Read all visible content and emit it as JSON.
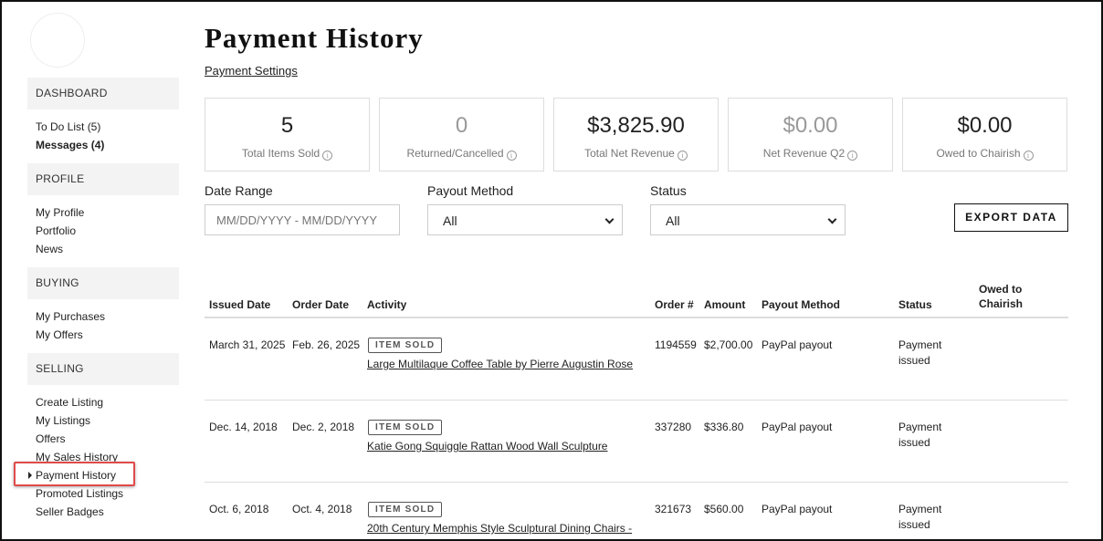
{
  "sidebar": {
    "sections": [
      {
        "title": "DASHBOARD",
        "items": [
          {
            "label": "To Do List (5)",
            "bold": false
          },
          {
            "label": "Messages (4)",
            "bold": true
          }
        ]
      },
      {
        "title": "PROFILE",
        "items": [
          {
            "label": "My Profile"
          },
          {
            "label": "Portfolio"
          },
          {
            "label": "News"
          }
        ]
      },
      {
        "title": "BUYING",
        "items": [
          {
            "label": "My Purchases"
          },
          {
            "label": "My Offers"
          }
        ]
      },
      {
        "title": "SELLING",
        "items": [
          {
            "label": "Create Listing"
          },
          {
            "label": "My Listings"
          },
          {
            "label": "Offers"
          },
          {
            "label": "My Sales History"
          },
          {
            "label": "Payment History",
            "active": true
          },
          {
            "label": "Promoted Listings"
          },
          {
            "label": "Seller Badges"
          }
        ]
      }
    ]
  },
  "page": {
    "title": "Payment History",
    "settings_link": "Payment Settings"
  },
  "stats": [
    {
      "value": "5",
      "label": "Total Items Sold",
      "muted": false
    },
    {
      "value": "0",
      "label": "Returned/Cancelled",
      "muted": true
    },
    {
      "value": "$3,825.90",
      "label": "Total Net Revenue",
      "muted": false
    },
    {
      "value": "$0.00",
      "label": "Net Revenue Q2",
      "muted": true
    },
    {
      "value": "$0.00",
      "label": "Owed to Chairish",
      "muted": false
    }
  ],
  "filters": {
    "date_range_label": "Date Range",
    "date_range_placeholder": "MM/DD/YYYY - MM/DD/YYYY",
    "payout_label": "Payout Method",
    "payout_value": "All",
    "status_label": "Status",
    "status_value": "All",
    "export_label": "EXPORT DATA"
  },
  "table": {
    "headers": {
      "issued_date": "Issued Date",
      "order_date": "Order Date",
      "activity": "Activity",
      "order_no": "Order #",
      "amount": "Amount",
      "payout_method": "Payout Method",
      "status": "Status",
      "owed_line1": "Owed to",
      "owed_line2": "Chairish"
    },
    "rows": [
      {
        "issued": "March 31, 2025",
        "ordered": "Feb. 26, 2025",
        "badge": "ITEM SOLD",
        "item": "Large Multilaque Coffee Table by Pierre Augustin Rose",
        "order": "1194559",
        "amount": "$2,700.00",
        "payout": "PayPal payout",
        "status1": "Payment",
        "status2": "issued"
      },
      {
        "issued": "Dec. 14, 2018",
        "ordered": "Dec. 2, 2018",
        "badge": "ITEM SOLD",
        "item": "Katie Gong Squiggle Rattan Wood Wall Sculpture",
        "order": "337280",
        "amount": "$336.80",
        "payout": "PayPal payout",
        "status1": "Payment",
        "status2": "issued"
      },
      {
        "issued": "Oct. 6, 2018",
        "ordered": "Oct. 4, 2018",
        "badge": "ITEM SOLD",
        "item": "20th Century Memphis Style Sculptural Dining Chairs -",
        "order": "321673",
        "amount": "$560.00",
        "payout": "PayPal payout",
        "status1": "Payment",
        "status2": "issued"
      }
    ]
  },
  "colors": {
    "highlight": "#e04a4a",
    "muted_text": "#999999"
  }
}
